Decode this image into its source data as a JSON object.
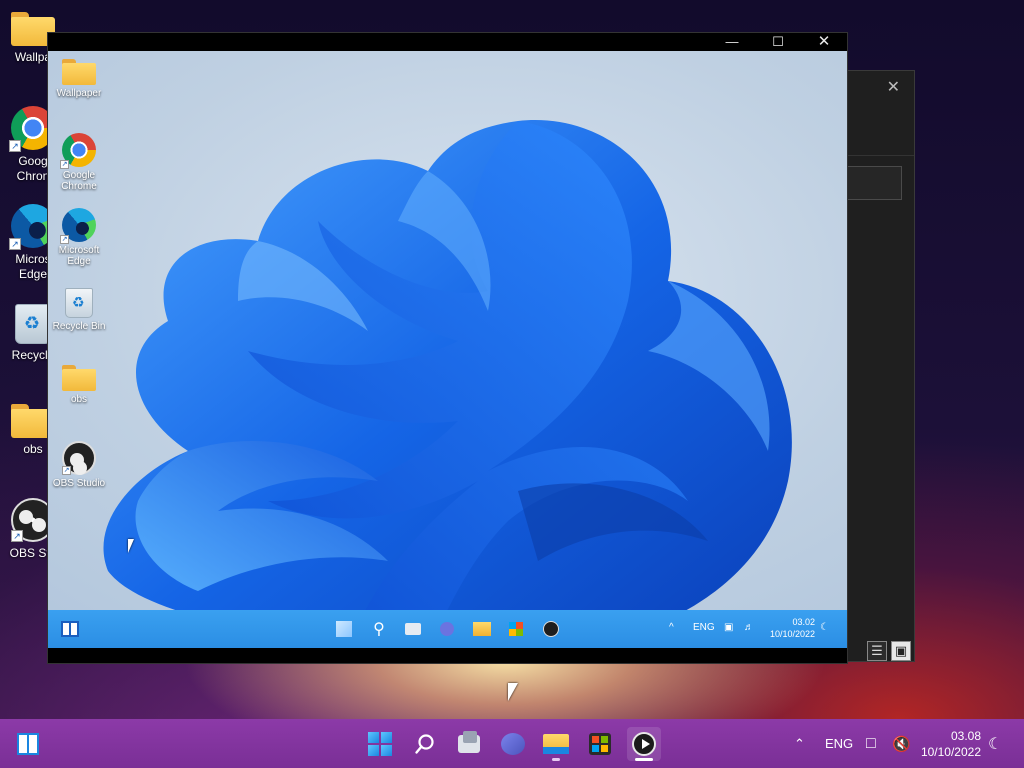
{
  "outer_desktop": {
    "icons": [
      {
        "label": "Wallpa",
        "icon": "folder-icon"
      },
      {
        "label": "Goog",
        "label2": "Chron",
        "icon": "chrome-icon"
      },
      {
        "label": "Micros",
        "label2": "Edge",
        "icon": "edge-icon"
      },
      {
        "label": "Recycle",
        "icon": "recycle-bin-icon"
      },
      {
        "label": "obs",
        "icon": "folder-icon"
      },
      {
        "label": "OBS Stu",
        "icon": "obs-icon"
      }
    ]
  },
  "background_window": {
    "close_glyph": "✕",
    "view_list_glyph": "☰",
    "view_grid_glyph": "▣"
  },
  "vm_window": {
    "min_glyph": "—",
    "max_glyph": "☐",
    "close_glyph": "✕",
    "guest": {
      "icons": [
        {
          "label": "Wallpaper",
          "icon": "folder-icon"
        },
        {
          "label": "Google",
          "label2": "Chrome",
          "icon": "chrome-icon"
        },
        {
          "label": "Microsoft",
          "label2": "Edge",
          "icon": "edge-icon"
        },
        {
          "label": "Recycle Bin",
          "icon": "recycle-bin-icon"
        },
        {
          "label": "obs",
          "icon": "folder-icon"
        },
        {
          "label": "OBS Studio",
          "icon": "obs-icon"
        }
      ],
      "taskbar": {
        "language": "ENG",
        "time": "03.02",
        "date": "10/10/2022"
      }
    }
  },
  "taskbar": {
    "language": "ENG",
    "time": "03.08",
    "date": "10/10/2022",
    "items": [
      "start",
      "search",
      "task-view",
      "chat",
      "file-explorer",
      "microsoft-store",
      "media-player"
    ]
  },
  "colors": {
    "taskbar": "#8c3aa8",
    "guest_taskbar": "#3aa0f0",
    "bloom_blue": "#1a6cf0"
  }
}
